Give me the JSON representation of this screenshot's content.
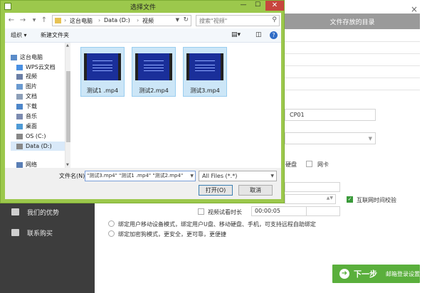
{
  "app": {
    "header_title": "文件存放的目录",
    "close_icon": "×",
    "sidebar": {
      "items": [
        {
          "label": "我们的优势",
          "icon": "star-icon"
        },
        {
          "label": "联系购买",
          "icon": "cart-icon"
        }
      ]
    },
    "form": {
      "device_prefix": "CP01",
      "checkbox_hdd_label": "硬盘",
      "checkbox_netcard_label": "网卡",
      "checkbox_net_time_label": "互联网时间校验",
      "video_preview_label": "视频试看时长",
      "video_preview_value": "00:00:05",
      "radio_mobile_label": "绑定用户移动设备模式，绑定用户U盘、移动硬盘、手机，可支持远程自助绑定",
      "radio_dongle_label": "绑定加密狗模式，更安全，更可靠，更便捷"
    },
    "next_button": {
      "label": "下一步",
      "sub_label": "邮箱登录设置"
    }
  },
  "dialog": {
    "title": "选择文件",
    "address": {
      "crumbs": [
        "这台电脑",
        "Data (D:)",
        "视频"
      ]
    },
    "search_placeholder": "搜索\"视频\"",
    "toolbar": {
      "organize": "组织 ▾",
      "new_folder": "新建文件夹"
    },
    "tree": [
      {
        "label": "这台电脑",
        "icon": "computer-icon",
        "color": "#5b8cc9"
      },
      {
        "label": "WPS云文档",
        "icon": "cloud-icon",
        "color": "#4a90e2"
      },
      {
        "label": "视频",
        "icon": "video-folder-icon",
        "color": "#6b7fa6"
      },
      {
        "label": "图片",
        "icon": "picture-folder-icon",
        "color": "#6a9ad0"
      },
      {
        "label": "文档",
        "icon": "documents-folder-icon",
        "color": "#8d9fb8"
      },
      {
        "label": "下载",
        "icon": "download-folder-icon",
        "color": "#4d86c9"
      },
      {
        "label": "音乐",
        "icon": "music-folder-icon",
        "color": "#7c8bb0"
      },
      {
        "label": "桌面",
        "icon": "desktop-folder-icon",
        "color": "#4f9bd6"
      },
      {
        "label": "OS (C:)",
        "icon": "drive-icon",
        "color": "#888888"
      },
      {
        "label": "Data (D:)",
        "icon": "drive-icon",
        "color": "#888888"
      },
      {
        "label": "网络",
        "icon": "network-icon",
        "color": "#5a7fb5"
      }
    ],
    "files": [
      {
        "name": "测试1 .mp4"
      },
      {
        "name": "测试2.mp4"
      },
      {
        "name": "测试3.mp4"
      }
    ],
    "filename_label": "文件名(N):",
    "filename_value": "\"测试3.mp4\" \"测试1 .mp4\" \"测试2.mp4\"",
    "filetype_value": "All Files (*.*)",
    "open_label": "打开(O)",
    "cancel_label": "取消"
  }
}
